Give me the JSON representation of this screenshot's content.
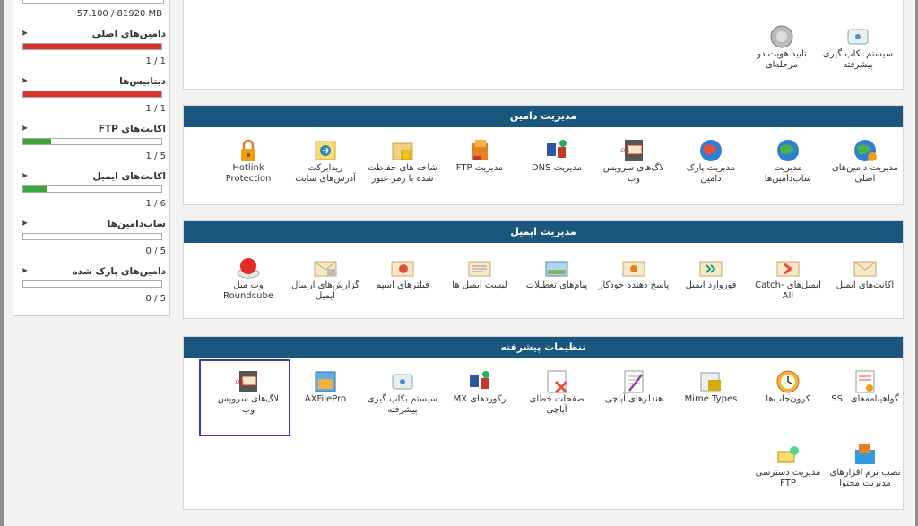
{
  "sidebar": {
    "disk_usage": "57.100 / 81920 MB",
    "stats": [
      {
        "label": "دامین‌های اصلی",
        "count": "1 / 1",
        "percent": 100,
        "color": "#d9342b"
      },
      {
        "label": "دیتابیس‌ها",
        "count": "1 / 1",
        "percent": 100,
        "color": "#d9342b"
      },
      {
        "label": "اکانت‌های FTP",
        "count": "1 / 5",
        "percent": 20,
        "color": "#3aa53a"
      },
      {
        "label": "اکانت‌های ایمیل",
        "count": "1 / 6",
        "percent": 17,
        "color": "#3aa53a"
      },
      {
        "label": "ساب‌دامین‌ها",
        "count": "0 / 5",
        "percent": 0,
        "color": "#3aa53a"
      },
      {
        "label": "دامین‌های پارک شده",
        "count": "0 / 5",
        "percent": 0,
        "color": "#3aa53a"
      }
    ]
  },
  "top_box": {
    "items": [
      {
        "label": "سیستم بکاپ گیری پیشرفته",
        "icon": "backup-disk-icon"
      },
      {
        "label": "تایید هویت دو مرحله‌ای",
        "icon": "two-factor-icon"
      }
    ]
  },
  "domain_panel": {
    "title": "مدیریت دامین",
    "items": [
      {
        "label": "مدیریت دامین‌های اصلی",
        "icon": "globe-gear-icon"
      },
      {
        "label": "مدیریت ساب‌دامین‌ها",
        "icon": "globe-icon"
      },
      {
        "label": "مدیریت پارک دامین",
        "icon": "globe-icon"
      },
      {
        "label": "لاگ‌های سرویس وب",
        "icon": "log-icon"
      },
      {
        "label": "مدیریت DNS",
        "icon": "dns-network-icon"
      },
      {
        "label": "مدیریت FTP",
        "icon": "ftp-folder-icon"
      },
      {
        "label": "شاخه های حفاظت شده با رمز عبور",
        "icon": "lock-folder-icon"
      },
      {
        "label": "ریدایرکت آدرس‌های سایت",
        "icon": "redirect-icon"
      },
      {
        "label": "Hotlink Protection",
        "icon": "lock-icon"
      }
    ]
  },
  "email_panel": {
    "title": "مدیریت ایمیل",
    "items": [
      {
        "label": "اکانت‌های ایمیل",
        "icon": "envelope-icon"
      },
      {
        "label": "ایمیل‌های Catch-All",
        "icon": "catch-all-icon"
      },
      {
        "label": "فوروارد ایمیل",
        "icon": "forward-mail-icon"
      },
      {
        "label": "پاسخ دهنده خودکار",
        "icon": "autoresponder-icon"
      },
      {
        "label": "پیام‌های تعطیلات",
        "icon": "vacation-icon"
      },
      {
        "label": "لیست ایمیل ها",
        "icon": "mail-list-icon"
      },
      {
        "label": "فیلترهای اسپم",
        "icon": "spam-filter-icon"
      },
      {
        "label": "گزارش‌های ارسال ایمیل",
        "icon": "mail-report-icon"
      },
      {
        "label": "وب میل Roundcube",
        "icon": "roundcube-icon"
      }
    ]
  },
  "advanced_panel": {
    "title": "تنظیمات پیشرفته",
    "items": [
      {
        "label": "گواهینامه‌های SSL",
        "icon": "certificate-icon"
      },
      {
        "label": "کرون‌جاب‌ها",
        "icon": "clock-icon"
      },
      {
        "label": "Mime Types",
        "icon": "mime-types-icon"
      },
      {
        "label": "هندلرهای آپاچی",
        "icon": "apache-handler-icon"
      },
      {
        "label": "صفحات خطای آپاچی",
        "icon": "error-page-icon"
      },
      {
        "label": "رکوردهای MX",
        "icon": "mx-records-icon"
      },
      {
        "label": "سیستم بکاپ گیری پیشرفته",
        "icon": "backup-disk-icon"
      },
      {
        "label": "AXFilePro",
        "icon": "file-manager-icon"
      },
      {
        "label": "لاگ‌های سرویس وب",
        "icon": "log-icon"
      },
      {
        "label": "نصب نرم افزارهای مدیریت محتوا",
        "icon": "installer-icon"
      },
      {
        "label": "مدیریت دسترسی FTP",
        "icon": "ftp-access-icon"
      }
    ]
  }
}
